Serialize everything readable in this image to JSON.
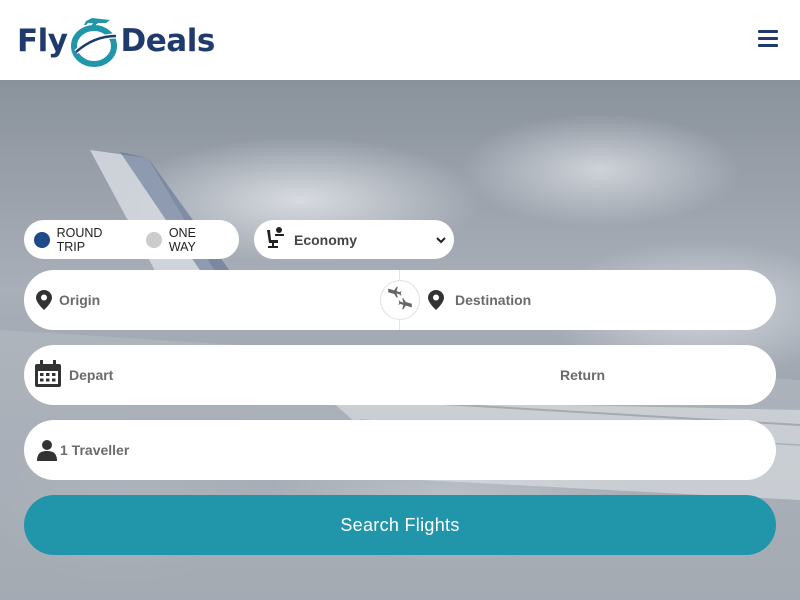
{
  "brand": {
    "logo_left": "Fly",
    "logo_right": "Deals",
    "primary_color": "#1f3a6d",
    "accent_color": "#2196ab"
  },
  "header": {
    "menu_icon": "hamburger-menu-icon"
  },
  "search_form": {
    "trip_types": [
      {
        "label": "ROUND TRIP",
        "selected": true
      },
      {
        "label": "ONE WAY",
        "selected": false
      }
    ],
    "cabin_class": {
      "icon": "seat-icon",
      "selected": "Economy"
    },
    "origin": {
      "icon": "map-pin-icon",
      "placeholder": "Origin"
    },
    "swap_icon": "swap-planes-icon",
    "destination": {
      "icon": "map-pin-icon",
      "placeholder": "Destination"
    },
    "depart": {
      "icon": "calendar-icon",
      "placeholder": "Depart"
    },
    "return": {
      "placeholder": "Return"
    },
    "travellers": {
      "icon": "user-icon",
      "value": "1 Traveller"
    },
    "submit_label": "Search Flights"
  }
}
